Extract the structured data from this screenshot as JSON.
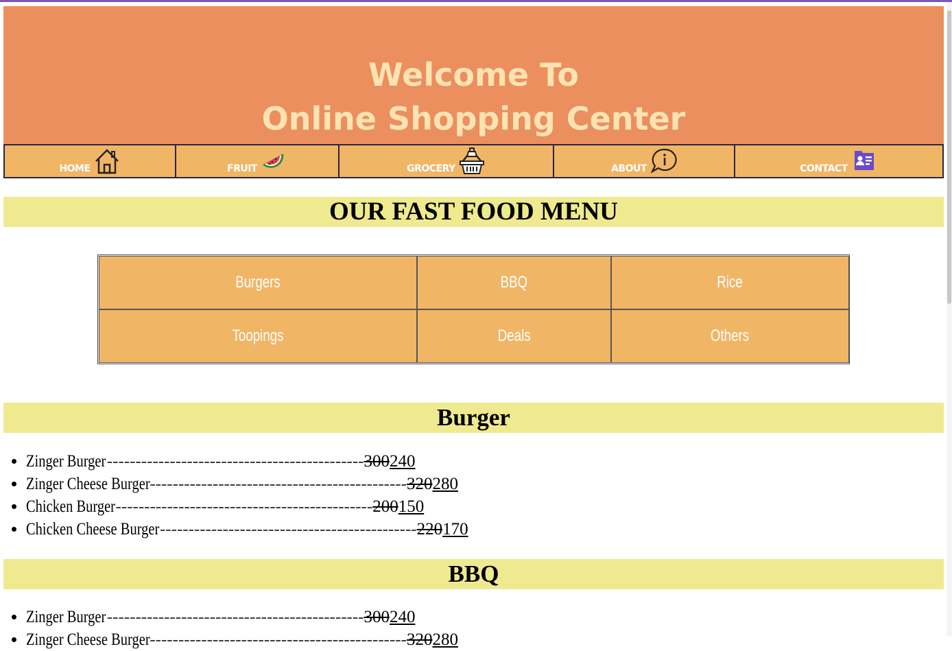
{
  "header": {
    "line1": "Welcome To",
    "line2": "Online Shopping Center"
  },
  "nav": [
    {
      "label": "HOME",
      "icon": "house-icon"
    },
    {
      "label": "FRUIT",
      "icon": "watermelon-icon"
    },
    {
      "label": "GROCERY",
      "icon": "basket-icon"
    },
    {
      "label": "ABOUT",
      "icon": "info-bubble-icon"
    },
    {
      "label": "CONTACT",
      "icon": "contact-card-icon"
    }
  ],
  "page_title": "OUR FAST FOOD MENU",
  "categories": [
    [
      "Burgers",
      "BBQ",
      "Rice"
    ],
    [
      "Toopings",
      "Deals",
      "Others"
    ]
  ],
  "sections": [
    {
      "title": "Burger",
      "items": [
        {
          "name": "Zinger Burger",
          "leader": "---------------------------------------------",
          "old_price": "300",
          "new_price": "240"
        },
        {
          "name": "Zinger Cheese Burger",
          "leader": "---------------------------------------------",
          "old_price": "320",
          "new_price": "280"
        },
        {
          "name": "Chicken Burger",
          "leader": "---------------------------------------------",
          "old_price": "200",
          "new_price": "150"
        },
        {
          "name": "Chicken Cheese Burger",
          "leader": "---------------------------------------------",
          "old_price": "220",
          "new_price": "170"
        }
      ]
    },
    {
      "title": "BBQ",
      "items": [
        {
          "name": "Zinger Burger",
          "leader": "---------------------------------------------",
          "old_price": "300",
          "new_price": "240"
        },
        {
          "name": "Zinger Cheese Burger",
          "leader": "---------------------------------------------",
          "old_price": "320",
          "new_price": "280"
        }
      ]
    }
  ],
  "colors": {
    "header_bg": "#eb8f5f",
    "header_text": "#fde3b2",
    "nav_bg": "#f1b566",
    "band_bg": "#efea8f",
    "accent_top": "#7a58b8"
  }
}
